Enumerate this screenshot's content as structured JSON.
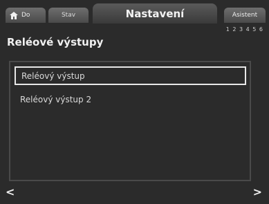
{
  "tabs": {
    "home_label": "Do",
    "status_label": "Stav",
    "active_label": "Nastavení",
    "assist_label": "Asistent"
  },
  "pager_info": "1 2 3 4 5 6",
  "page_title": "Reléové výstupy",
  "list": [
    {
      "label": "Reléový výstup",
      "selected": true
    },
    {
      "label": "Reléový výstup 2",
      "selected": false
    }
  ],
  "nav": {
    "back": "<",
    "forward": ">"
  }
}
